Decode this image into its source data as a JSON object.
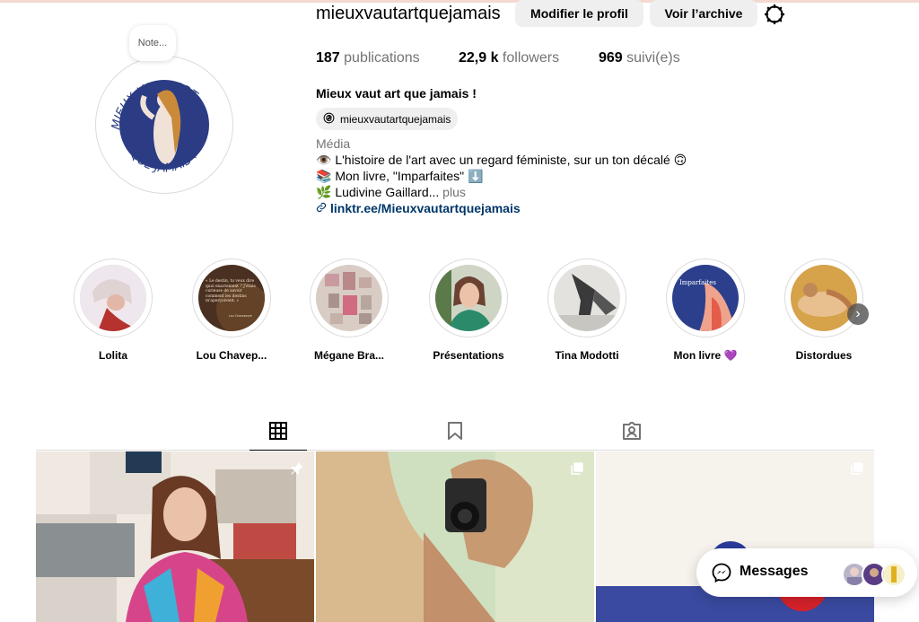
{
  "profile": {
    "username": "mieuxvautartquejamais",
    "note_label": "Note...",
    "edit_button": "Modifier le profil",
    "archive_button": "Voir l’archive",
    "stats": {
      "publications_count": "187",
      "publications_label": " publications",
      "followers_count": "22,9 k",
      "followers_label": " followers",
      "following_count": "969",
      "following_label": " suivi(e)s"
    },
    "full_name": "Mieux vaut art que jamais !",
    "threads_handle": "mieuxvautartquejamais",
    "category": "Média",
    "bio_line1": "👁️ L'histoire de l'art avec un regard féministe, sur un ton décalé 🙃",
    "bio_line2": "📚 Mon livre, \"Imparfaites\" ⬇️",
    "bio_line3": "🌿 Ludivine Gaillard... ",
    "bio_more": "plus",
    "link": "linktr.ee/Mieuxvautartquejamais",
    "avatar_text_top": "MIEUX VAUT ART",
    "avatar_text_bottom": "QUE JAMAIS !"
  },
  "highlights": [
    {
      "label": "Lolita",
      "color": "#d9b6b0"
    },
    {
      "label": "Lou Chavep...",
      "color": "#5a3b22"
    },
    {
      "label": "Mégane Bra...",
      "color": "#cfc0b6"
    },
    {
      "label": "Présentations",
      "color": "#2f7a5a"
    },
    {
      "label": "Tina Modotti",
      "color": "#8f8f8f"
    },
    {
      "label": "Mon livre 💜",
      "color": "#2b3f8c"
    },
    {
      "label": "Distordues",
      "color": "#c99540"
    }
  ],
  "highlight_quote": "« Le destin, tu veux dire quoi exactement ? J'étais curieuse de savoir comment les destins m'aperçoivent. »",
  "highlight_quote_author": "Lou Chavepeyre",
  "book_title_on_cover": "Imparfaites",
  "tabs": [
    {
      "name": "posts",
      "icon": "grid-icon",
      "active": true
    },
    {
      "name": "saved",
      "icon": "bookmark-icon",
      "active": false
    },
    {
      "name": "tagged",
      "icon": "tagged-user-icon",
      "active": false
    }
  ],
  "posts": [
    {
      "badge": "pin-icon"
    },
    {
      "badge": "carousel-icon"
    },
    {
      "badge": "carousel-icon"
    }
  ],
  "messages": {
    "label": "Messages"
  },
  "colors": {
    "brand_navy": "#2b3c84",
    "link": "#00376b",
    "button_bg": "#efefef",
    "muted_text": "#737373"
  }
}
